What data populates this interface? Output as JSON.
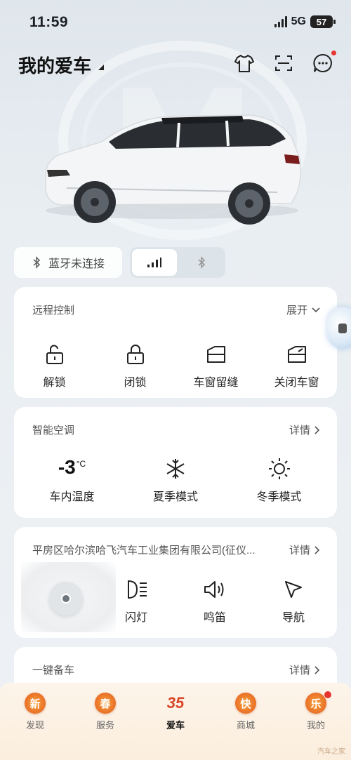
{
  "status": {
    "time": "11:59",
    "network": "5G",
    "battery": "57"
  },
  "header": {
    "title": "我的爱车"
  },
  "bluetooth": {
    "label": "蓝牙未连接"
  },
  "remote_control": {
    "title": "远程控制",
    "more": "展开",
    "items": [
      {
        "label": "解锁",
        "icon": "unlock-icon"
      },
      {
        "label": "闭锁",
        "icon": "lock-icon"
      },
      {
        "label": "车窗留缝",
        "icon": "window-gap-icon"
      },
      {
        "label": "关闭车窗",
        "icon": "window-close-icon"
      }
    ]
  },
  "climate": {
    "title": "智能空调",
    "more": "详情",
    "temperature": "-3",
    "temperature_unit": "°C",
    "items": [
      {
        "label": "车内温度"
      },
      {
        "label": "夏季模式",
        "icon": "snowflake-icon"
      },
      {
        "label": "冬季模式",
        "icon": "sun-icon"
      }
    ]
  },
  "location": {
    "title": "平房区哈尔滨哈飞汽车工业集团有限公司(征仪...",
    "more": "详情",
    "items": [
      {
        "label": "闪灯",
        "icon": "headlight-icon"
      },
      {
        "label": "鸣笛",
        "icon": "horn-icon"
      },
      {
        "label": "导航",
        "icon": "navigate-icon"
      }
    ]
  },
  "prep": {
    "title": "一键备车",
    "more": "详情"
  },
  "tabbar": {
    "tabs": [
      {
        "label": "发现",
        "badge": "新"
      },
      {
        "label": "服务",
        "badge": "春"
      },
      {
        "label": "爱车",
        "badge": "35"
      },
      {
        "label": "商城",
        "badge": "快"
      },
      {
        "label": "我的",
        "badge": "乐"
      }
    ]
  },
  "watermark": "汽车之家"
}
